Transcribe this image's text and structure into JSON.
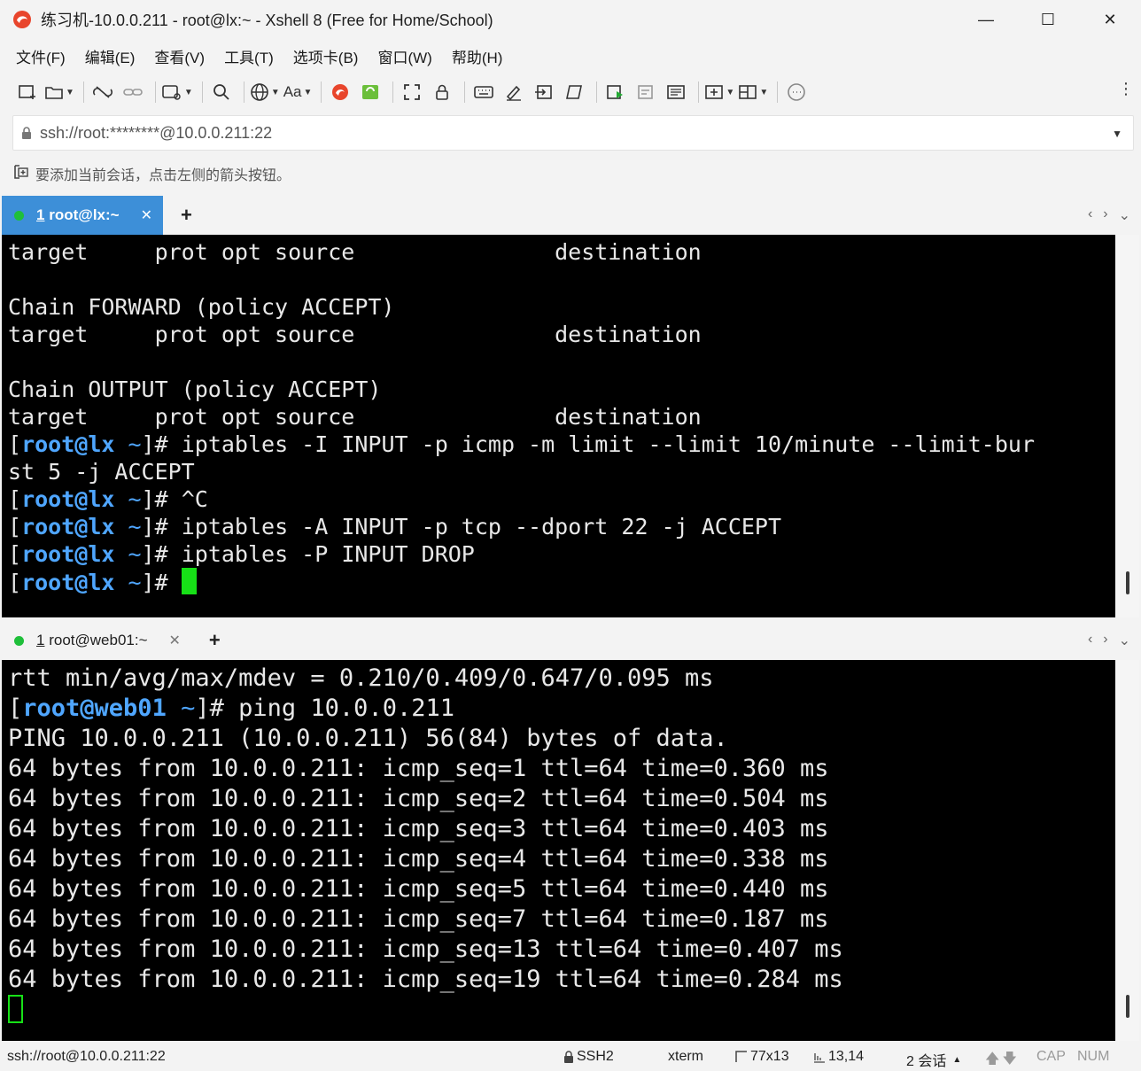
{
  "window": {
    "title": "练习机-10.0.0.211 - root@lx:~ - Xshell 8 (Free for Home/School)",
    "logo_icon": "xshell-logo-icon",
    "minimize_glyph": "—",
    "maximize_glyph": "☐",
    "close_glyph": "✕"
  },
  "menu": [
    {
      "label": "文件(F)"
    },
    {
      "label": "编辑(E)"
    },
    {
      "label": "查看(V)"
    },
    {
      "label": "工具(T)"
    },
    {
      "label": "选项卡(B)"
    },
    {
      "label": "窗口(W)"
    },
    {
      "label": "帮助(H)"
    }
  ],
  "toolbar": {
    "font_button_label": "Aa",
    "more_glyph": "⋮"
  },
  "address": {
    "value": "ssh://root:********@10.0.0.211:22"
  },
  "hint": {
    "text": "要添加当前会话，点击左侧的箭头按钮。"
  },
  "tabs_top": {
    "tab_number": "1",
    "tab_label": "root@lx:~",
    "add_glyph": "+",
    "prev_glyph": "‹",
    "next_glyph": "›",
    "menu_glyph": "⌄"
  },
  "tabs_bottom": {
    "tab_number": "1",
    "tab_label": "root@web01:~",
    "add_glyph": "+",
    "prev_glyph": "‹",
    "next_glyph": "›",
    "menu_glyph": "⌄"
  },
  "colors": {
    "tab_active_bg": "#3d8fd8",
    "prompt_blue": "#4fa6ff",
    "cursor_green": "#17e017",
    "session_dot": "#1fbf3a"
  },
  "terminal_top": {
    "lines": [
      "target     prot opt source               destination",
      "",
      "Chain FORWARD (policy ACCEPT)",
      "target     prot opt source               destination",
      "",
      "Chain OUTPUT (policy ACCEPT)",
      "target     prot opt source               destination"
    ],
    "prompt_user": "root@lx",
    "prompt_path": "~",
    "prompt_open": "[",
    "prompt_close": "]#",
    "commands": [
      "iptables -I INPUT -p icmp -m limit --limit 10/minute --limit-bur",
      "^C",
      "iptables -A INPUT -p tcp --dport 22 -j ACCEPT",
      "iptables -P INPUT DROP",
      ""
    ],
    "wrap_line": "st 5 -j ACCEPT"
  },
  "terminal_bottom": {
    "first_line": "rtt min/avg/max/mdev = 0.210/0.409/0.647/0.095 ms",
    "prompt_user": "root@web01",
    "prompt_path": "~",
    "prompt_open": "[",
    "prompt_close": "]#",
    "command": "ping 10.0.0.211",
    "lines": [
      "PING 10.0.0.211 (10.0.0.211) 56(84) bytes of data.",
      "64 bytes from 10.0.0.211: icmp_seq=1 ttl=64 time=0.360 ms",
      "64 bytes from 10.0.0.211: icmp_seq=2 ttl=64 time=0.504 ms",
      "64 bytes from 10.0.0.211: icmp_seq=3 ttl=64 time=0.403 ms",
      "64 bytes from 10.0.0.211: icmp_seq=4 ttl=64 time=0.338 ms",
      "64 bytes from 10.0.0.211: icmp_seq=5 ttl=64 time=0.440 ms",
      "64 bytes from 10.0.0.211: icmp_seq=7 ttl=64 time=0.187 ms",
      "64 bytes from 10.0.0.211: icmp_seq=13 ttl=64 time=0.407 ms",
      "64 bytes from 10.0.0.211: icmp_seq=19 ttl=64 time=0.284 ms"
    ]
  },
  "status": {
    "connection": "ssh://root@10.0.0.211:22",
    "protocol": "SSH2",
    "terminal_type": "xterm",
    "size": "77x13",
    "cursor_pos": "13,14",
    "sessions": "2 会话",
    "cap": "CAP",
    "num": "NUM"
  }
}
